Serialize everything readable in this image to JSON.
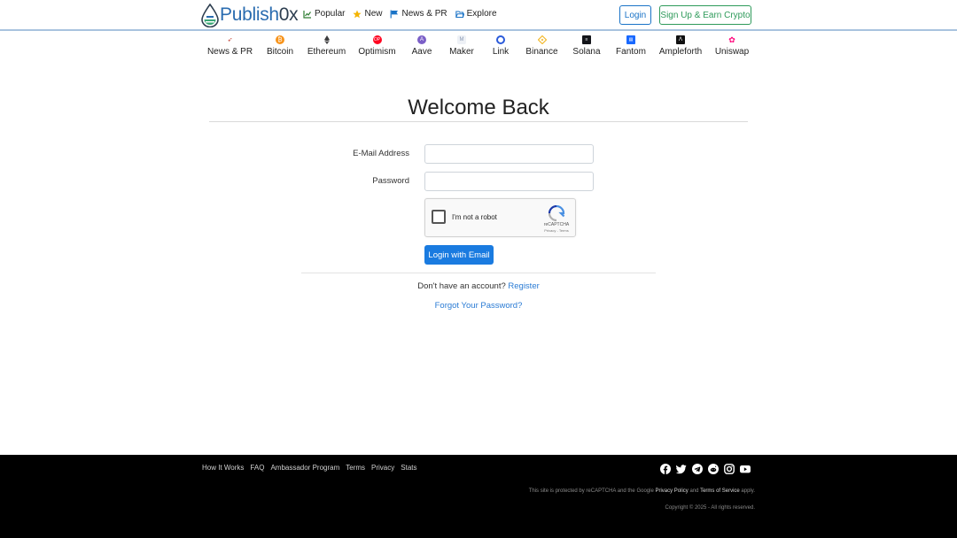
{
  "brand": {
    "name_main": "Publish",
    "name_suffix": "0x"
  },
  "topnav": [
    {
      "label": "Popular",
      "icon": "chart-line-icon"
    },
    {
      "label": "New",
      "icon": "star-icon"
    },
    {
      "label": "News & PR",
      "icon": "flag-icon"
    },
    {
      "label": "Explore",
      "icon": "folder-open-icon"
    }
  ],
  "auth": {
    "login_label": "Login",
    "signup_label": "Sign Up & Earn Crypto"
  },
  "categories": [
    {
      "label": "News & PR",
      "color": "#c0392b"
    },
    {
      "label": "Bitcoin",
      "color": "#f7931a"
    },
    {
      "label": "Ethereum",
      "color": "#3c3c3d"
    },
    {
      "label": "Optimism",
      "color": "#ff0420"
    },
    {
      "label": "Aave",
      "color": "#7b5fc7"
    },
    {
      "label": "Maker",
      "color": "#b8c4d6"
    },
    {
      "label": "Link",
      "color": "#2a5ada"
    },
    {
      "label": "Binance",
      "color": "#f3ba2f"
    },
    {
      "label": "Solana",
      "color": "#14151a"
    },
    {
      "label": "Fantom",
      "color": "#1969ff"
    },
    {
      "label": "Ampleforth",
      "color": "#111111"
    },
    {
      "label": "Uniswap",
      "color": "#ff007a"
    }
  ],
  "login": {
    "title": "Welcome Back",
    "email_label": "E-Mail Address",
    "password_label": "Password",
    "captcha_text": "I'm not a robot",
    "captcha_brand": "reCAPTCHA",
    "captcha_links": "Privacy - Terms",
    "submit_label": "Login with Email",
    "no_account_text": "Don't have an account?",
    "register_label": "Register",
    "forgot_label": "Forgot Your Password?"
  },
  "footer": {
    "links": [
      "How It Works",
      "FAQ",
      "Ambassador Program",
      "Terms",
      "Privacy",
      "Stats"
    ],
    "social": [
      "facebook-icon",
      "twitter-icon",
      "telegram-icon",
      "reddit-icon",
      "instagram-icon",
      "youtube-icon"
    ],
    "recaptcha_note_prefix": "This site is protected by reCAPTCHA and the Google",
    "privacy_policy": "Privacy Policy",
    "and": "and",
    "terms_of_service": "Terms of Service",
    "apply": "apply.",
    "copyright": "Copyright © 2025 - All rights reserved."
  }
}
